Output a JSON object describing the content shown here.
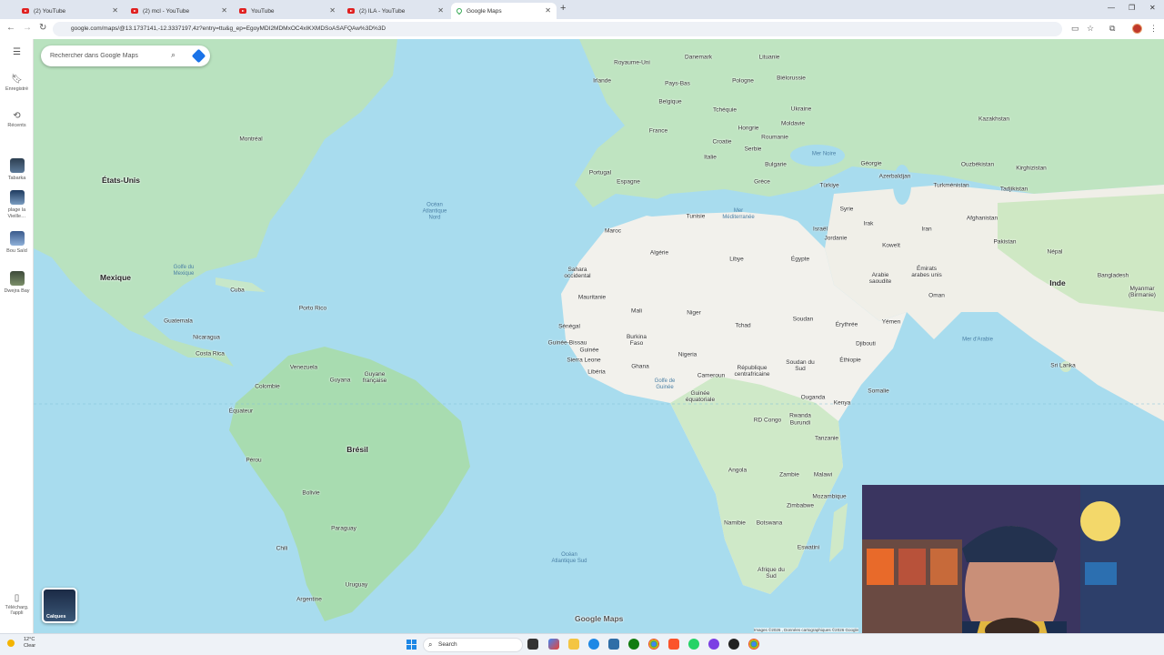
{
  "browser": {
    "tabs": [
      {
        "label": "(2) YouTube",
        "icon": "youtube-icon"
      },
      {
        "label": "(2) mcl - YouTube",
        "icon": "youtube-icon"
      },
      {
        "label": "YouTube",
        "icon": "youtube-icon"
      },
      {
        "label": "(2) ILA - YouTube",
        "icon": "youtube-icon"
      },
      {
        "label": "Google Maps",
        "icon": "maps-pin-icon",
        "active": true
      }
    ],
    "url": "google.com/maps/@13.1737141,-12.3337197,4z?entry=ttu&g_ep=EgoyMDI2MDMxOC4xIKXMDSoASAFQAw%3D%3D"
  },
  "sidebar": {
    "menu_icon": "hamburger-icon",
    "items": [
      {
        "label": "Enregistré",
        "icon": "bookmark-icon"
      },
      {
        "label": "Récents",
        "icon": "history-icon"
      },
      {
        "label": "Tabarka",
        "icon": "place-thumbnail"
      },
      {
        "label": "plage la Vieille…",
        "icon": "place-thumbnail"
      },
      {
        "label": "Bou Saïd",
        "icon": "place-thumbnail"
      },
      {
        "label": "Dwejra Bay",
        "icon": "place-thumbnail"
      }
    ],
    "download": "Télécharg. l'appli"
  },
  "search": {
    "placeholder": "Rechercher dans Google Maps"
  },
  "map": {
    "layers_label": "Calques",
    "logo": "Google Maps",
    "attribution": "Images ©2026 , Données cartographiques ©2026 Google",
    "countries": {
      "usa": "États-Unis",
      "canada_city_montreal": "Montréal",
      "mexico": "Mexique",
      "cuba": "Cuba",
      "guatemala": "Guatemala",
      "nicaragua": "Nicaragua",
      "costa_rica": "Costa Rica",
      "puerto_rico": "Porto Rico",
      "venezuela": "Venezuela",
      "colombia": "Colombie",
      "guyana": "Guyana",
      "french_guiana": "Guyane française",
      "ecuador": "Équateur",
      "peru": "Pérou",
      "brazil": "Brésil",
      "bolivia": "Bolivie",
      "paraguay": "Paraguay",
      "chile": "Chili",
      "uruguay": "Uruguay",
      "argentina": "Argentine",
      "uk": "Royaume-Uni",
      "ireland": "Irlande",
      "denmark": "Danemark",
      "lithuania": "Lituanie",
      "belarus": "Biélorussie",
      "netherlands": "Pays-Bas",
      "poland": "Pologne",
      "belgium": "Belgique",
      "czech": "Tchéquie",
      "ukraine": "Ukraine",
      "france": "France",
      "hungary": "Hongrie",
      "moldova": "Moldavie",
      "croatia": "Croatie",
      "romania": "Roumanie",
      "serbia": "Serbie",
      "italy": "Italie",
      "bulgaria": "Bulgarie",
      "greece": "Grèce",
      "turkey": "Türkiye",
      "portugal": "Portugal",
      "spain": "Espagne",
      "tunisia": "Tunisie",
      "morocco": "Maroc",
      "algeria": "Algérie",
      "libya": "Libye",
      "egypt": "Égypte",
      "western_sahara": "Sahara occidental",
      "mauritania": "Mauritanie",
      "mali": "Mali",
      "niger": "Niger",
      "chad": "Tchad",
      "sudan": "Soudan",
      "senegal": "Sénégal",
      "guinea_bissau": "Guinée-Bissau",
      "guinea": "Guinée",
      "sierra_leone": "Sierra Leone",
      "liberia": "Libéria",
      "burkina": "Burkina Faso",
      "ghana": "Ghana",
      "nigeria": "Nigeria",
      "cameroon": "Cameroun",
      "car": "République centrafricaine",
      "south_sudan": "Soudan du Sud",
      "ethiopia": "Éthiopie",
      "eritrea": "Érythrée",
      "djibouti": "Djibouti",
      "somalia": "Somalie",
      "eq_guinea": "Guinée équatoriale",
      "drc": "RD Congo",
      "uganda": "Ouganda",
      "kenya": "Kenya",
      "rwanda": "Rwanda",
      "burundi": "Burundi",
      "tanzania": "Tanzanie",
      "angola": "Angola",
      "zambia": "Zambie",
      "malawi": "Malawi",
      "mozambique": "Mozambique",
      "zimbabwe": "Zimbabwe",
      "namibia": "Namibie",
      "botswana": "Botswana",
      "eswatini": "Eswatini",
      "south_africa": "Afrique du Sud",
      "syria": "Syrie",
      "iraq": "Irak",
      "israel": "Israël",
      "jordan": "Jordanie",
      "kuwait": "Koweït",
      "iran": "Iran",
      "saudi": "Arabie saoudite",
      "uae": "Émirats arabes unis",
      "oman": "Oman",
      "yemen": "Yémen",
      "georgia": "Géorgie",
      "azerbaijan": "Azerbaïdjan",
      "turkmenistan": "Turkménistan",
      "uzbekistan": "Ouzbékistan",
      "kazakhstan": "Kazakhstan",
      "kyrgyzstan": "Kirghizistan",
      "tajikistan": "Tadjikistan",
      "afghanistan": "Afghanistan",
      "pakistan": "Pakistan",
      "nepal": "Népal",
      "india": "Inde",
      "bangladesh": "Bangladesh",
      "myanmar": "Myanmar (Birmanie)",
      "sri_lanka": "Sri Lanka"
    },
    "seas": {
      "north_atlantic": "Océan Atlantique Nord",
      "south_atlantic": "Océan Atlantique Sud",
      "mediterranean": "Mer Méditerranée",
      "black_sea": "Mer Noire",
      "arabian_sea": "Mer d'Arabie",
      "gulf_of_guinea": "Golfe de Guinée",
      "gulf_mexico": "Golfe du Mexique"
    }
  },
  "taskbar": {
    "weather_temp": "12°C",
    "weather_desc": "Clear",
    "search_label": "Search"
  }
}
